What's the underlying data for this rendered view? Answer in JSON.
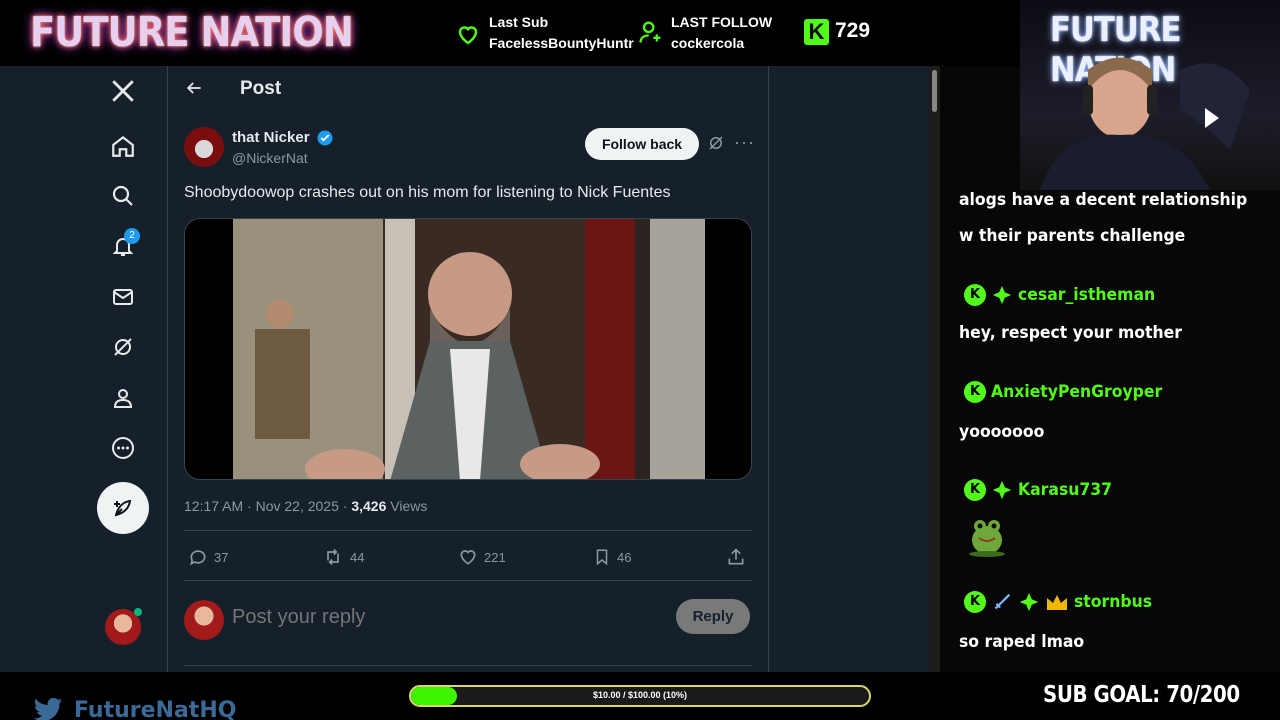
{
  "overlay": {
    "brand": "FUTURE NATION",
    "last_sub_label": "Last Sub",
    "last_sub_name": "FacelessBountyHuntr",
    "last_follow_label": "LAST FOLLOW",
    "last_follow_name": "cockercola",
    "kick_badge": "K",
    "kick_count": "729",
    "twitter_handle": "FutureNatHQ",
    "progress_text": "$10.00 / $100.00 (10%)",
    "progress_fraction": 0.1,
    "sub_goal": "SUB GOAL: 70/200",
    "cam_brand": "FUTURE NATION",
    "accent": "#53fc18"
  },
  "sidebar": {
    "notifications_count": "2",
    "icons": [
      "x-logo-icon",
      "home-icon",
      "search-icon",
      "bell-icon",
      "mail-icon",
      "grok-icon",
      "profile-icon",
      "more-icon",
      "compose-icon"
    ]
  },
  "post": {
    "header_title": "Post",
    "author_name": "that Nicker",
    "author_handle": "@NickerNat",
    "follow_label": "Follow back",
    "more_label": "···",
    "text": "Shoobydoowop crashes out on his mom for listening to Nick Fuentes",
    "time": "12:17 AM · Nov 22, 2025 · ",
    "views_count": "3,426",
    "views_label": " Views",
    "replies": "37",
    "reposts": "44",
    "likes": "221",
    "bookmarks": "46",
    "reply_placeholder": "Post your reply",
    "reply_button": "Reply",
    "accent": "#1d9bf0"
  },
  "chat": {
    "messages": [
      {
        "text": "alogs have a decent relationship"
      },
      {
        "text": "w their parents challenge"
      },
      {
        "user": "cesar_istheman",
        "text": "hey, respect your mother"
      },
      {
        "user": "AnxietyPenGroyper",
        "text": "yooooooo"
      },
      {
        "user": "Karasu737",
        "text": ""
      },
      {
        "user": "stornbus",
        "text": "so raped lmao"
      }
    ]
  }
}
